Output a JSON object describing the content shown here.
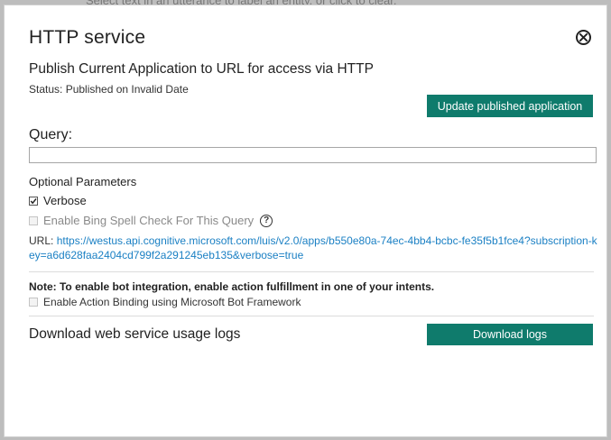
{
  "background": {
    "hint_text": "Select text in an utterance to label an entity, or click to clear."
  },
  "dialog": {
    "title": "HTTP service",
    "subtitle": "Publish Current Application to URL for access via HTTP",
    "status": "Status: Published on Invalid Date",
    "update_button": "Update published application",
    "query_label": "Query:",
    "query_value": "",
    "optional_heading": "Optional Parameters",
    "verbose_label": "Verbose",
    "verbose_checked": true,
    "bing_label": "Enable Bing Spell Check For This Query",
    "bing_checked": false,
    "help_glyph": "?",
    "url_prefix": "URL:",
    "url": "https://westus.api.cognitive.microsoft.com/luis/v2.0/apps/b550e80a-74ec-4bb4-bcbc-fe35f5b1fce4?subscription-key=a6d628faa2404cd799f2a291245eb135&verbose=true",
    "note": "Note: To enable bot integration, enable action fulfillment in one of your intents.",
    "action_binding_label": "Enable Action Binding using Microsoft Bot Framework",
    "action_binding_checked": false,
    "download_label": "Download web service usage logs",
    "download_button": "Download logs"
  },
  "icons": {
    "close": "close-circle-icon",
    "help": "help-circle-icon",
    "check": "checkmark-icon"
  },
  "colors": {
    "accent": "#0f7b6c",
    "link": "#1b80c4",
    "disabled_text": "#8a8a8a"
  }
}
